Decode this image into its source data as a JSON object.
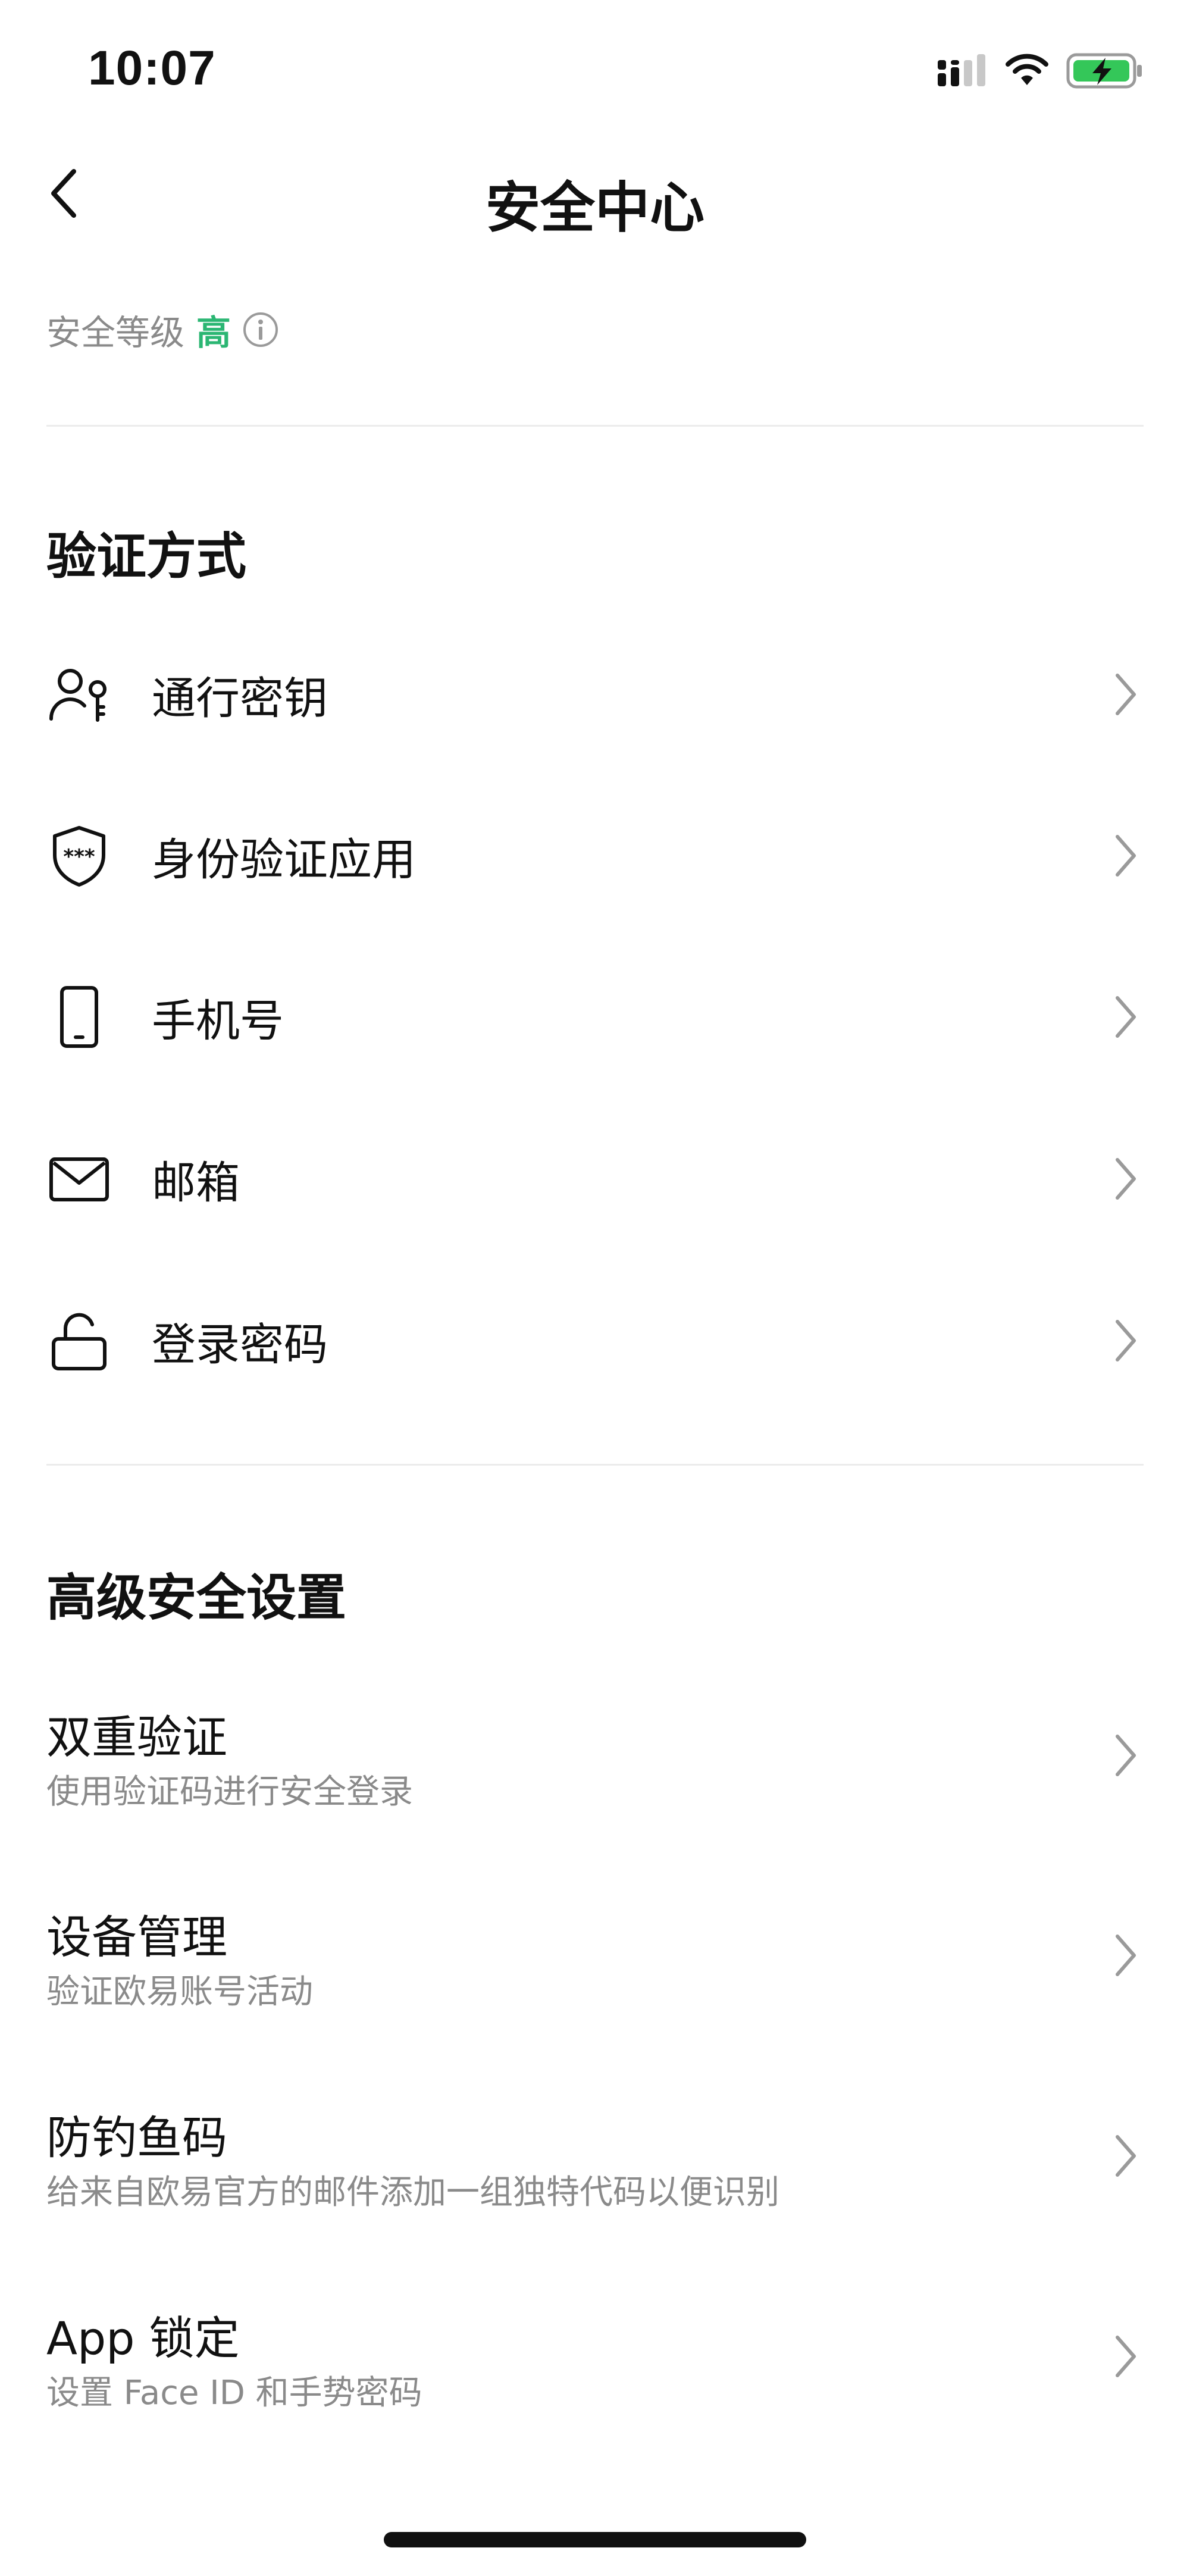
{
  "status_bar": {
    "time": "10:07"
  },
  "nav": {
    "title": "安全中心"
  },
  "security_level": {
    "label": "安全等级",
    "value": "高",
    "value_color": "#2bb673"
  },
  "verification": {
    "title": "验证方式",
    "items": [
      {
        "label": "通行密钥",
        "icon": "user-key-icon"
      },
      {
        "label": "身份验证应用",
        "icon": "shield-password-icon"
      },
      {
        "label": "手机号",
        "icon": "phone-icon"
      },
      {
        "label": "邮箱",
        "icon": "mail-icon"
      },
      {
        "label": "登录密码",
        "icon": "unlock-icon"
      }
    ]
  },
  "advanced": {
    "title": "高级安全设置",
    "items": [
      {
        "title": "双重验证",
        "subtitle": "使用验证码进行安全登录"
      },
      {
        "title": "设备管理",
        "subtitle": "验证欧易账号活动"
      },
      {
        "title": "防钓鱼码",
        "subtitle": "给来自欧易官方的邮件添加一组独特代码以便识别"
      },
      {
        "title": "App 锁定",
        "subtitle": "设置 Face ID 和手势密码"
      }
    ]
  }
}
